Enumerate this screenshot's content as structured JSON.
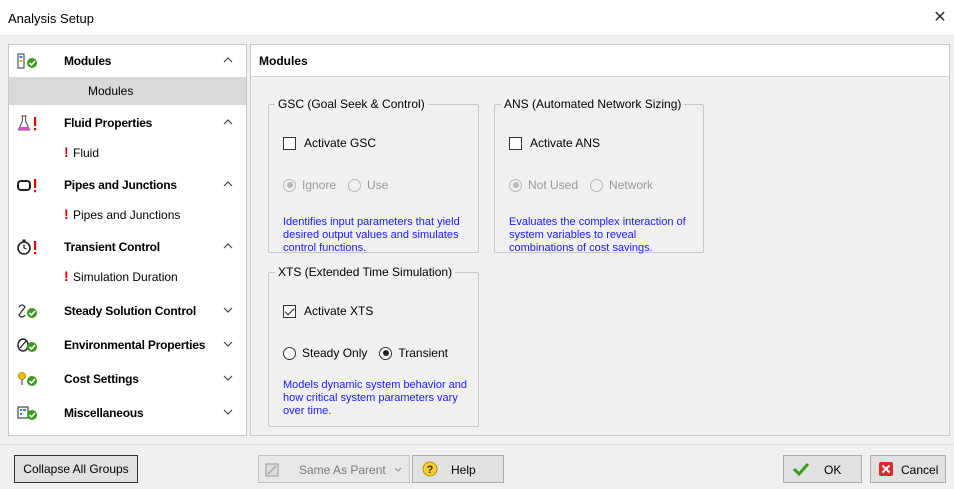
{
  "window": {
    "title": "Analysis Setup",
    "close_glyph": "✕"
  },
  "sidebar": {
    "groups": [
      {
        "label": "Modules",
        "icon": "modules-ok-icon",
        "expanded": true,
        "items": [
          {
            "label": "Modules",
            "selected": true,
            "warning": false
          }
        ]
      },
      {
        "label": "Fluid Properties",
        "icon": "flask-warning-icon",
        "expanded": true,
        "items": [
          {
            "label": "Fluid",
            "warning": true
          }
        ]
      },
      {
        "label": "Pipes and Junctions",
        "icon": "pipe-warning-icon",
        "expanded": true,
        "items": [
          {
            "label": "Pipes and Junctions",
            "warning": true
          }
        ]
      },
      {
        "label": "Transient Control",
        "icon": "stopwatch-warning-icon",
        "expanded": true,
        "items": [
          {
            "label": "Simulation Duration",
            "warning": true
          }
        ]
      },
      {
        "label": "Steady Solution Control",
        "icon": "solution-ok-icon",
        "expanded": false,
        "items": []
      },
      {
        "label": "Environmental Properties",
        "icon": "environment-ok-icon",
        "expanded": false,
        "items": []
      },
      {
        "label": "Cost Settings",
        "icon": "cost-ok-icon",
        "expanded": false,
        "items": []
      },
      {
        "label": "Miscellaneous",
        "icon": "misc-ok-icon",
        "expanded": false,
        "items": []
      }
    ],
    "warning_glyph": "!"
  },
  "main": {
    "title": "Modules",
    "gsc": {
      "legend": "GSC (Goal Seek & Control)",
      "activate_label": "Activate GSC",
      "activate_checked": false,
      "radio_options": [
        "Ignore",
        "Use"
      ],
      "radio_selected": "Ignore",
      "enabled": false,
      "description": "Identifies input parameters that yield desired output values and simulates control functions."
    },
    "ans": {
      "legend": "ANS (Automated Network Sizing)",
      "activate_label": "Activate ANS",
      "activate_checked": false,
      "radio_options": [
        "Not Used",
        "Network"
      ],
      "radio_selected": "Not Used",
      "enabled": false,
      "description": "Evaluates the complex interaction of system variables to reveal combinations of cost savings."
    },
    "xts": {
      "legend": "XTS (Extended Time Simulation)",
      "activate_label": "Activate XTS",
      "activate_checked": true,
      "radio_options": [
        "Steady Only",
        "Transient"
      ],
      "radio_selected": "Transient",
      "enabled": true,
      "description": "Models dynamic system behavior and how critical system parameters vary over time."
    }
  },
  "footer": {
    "collapse_label": "Collapse All Groups",
    "same_as_parent_label": "Same As Parent",
    "help_label": "Help",
    "ok_label": "OK",
    "cancel_label": "Cancel"
  },
  "colors": {
    "ok_green": "#3c9a1e",
    "warning_red": "#e00000",
    "description_blue": "#1a1aff",
    "selected_item_bg": "#d9d9d9"
  }
}
